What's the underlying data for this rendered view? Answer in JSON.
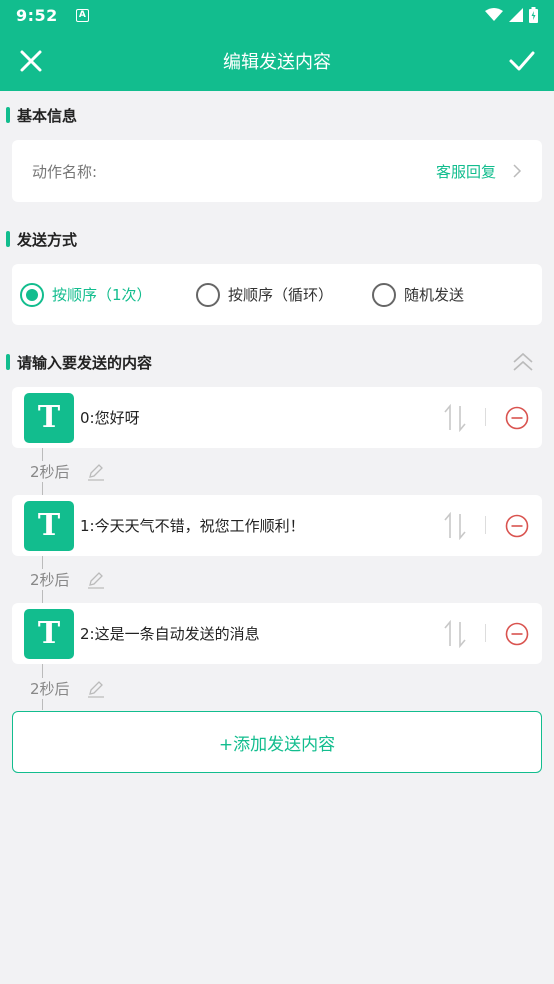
{
  "status_bar": {
    "time": "9:52",
    "notification_icon": "A"
  },
  "app_bar": {
    "title": "编辑发送内容"
  },
  "basic_info": {
    "section_title": "基本信息",
    "name_label": "动作名称:",
    "name_value": "客服回复"
  },
  "send_mode": {
    "section_title": "发送方式",
    "options": [
      {
        "label": "按顺序（1次）",
        "selected": true
      },
      {
        "label": "按顺序（循环）",
        "selected": false
      },
      {
        "label": "随机发送",
        "selected": false
      }
    ]
  },
  "content": {
    "section_title": "请输入要发送的内容",
    "items": [
      {
        "icon_letter": "T",
        "text": "0:您好呀",
        "delay": "2秒后"
      },
      {
        "icon_letter": "T",
        "text": "1:今天天气不错，祝您工作顺利！",
        "delay": "2秒后"
      },
      {
        "icon_letter": "T",
        "text": "2:这是一条自动发送的消息",
        "delay": "2秒后"
      }
    ],
    "add_button_label": "+添加发送内容"
  },
  "colors": {
    "accent": "#12bd8e",
    "danger": "#d9534f",
    "background": "#f2f2f4"
  }
}
